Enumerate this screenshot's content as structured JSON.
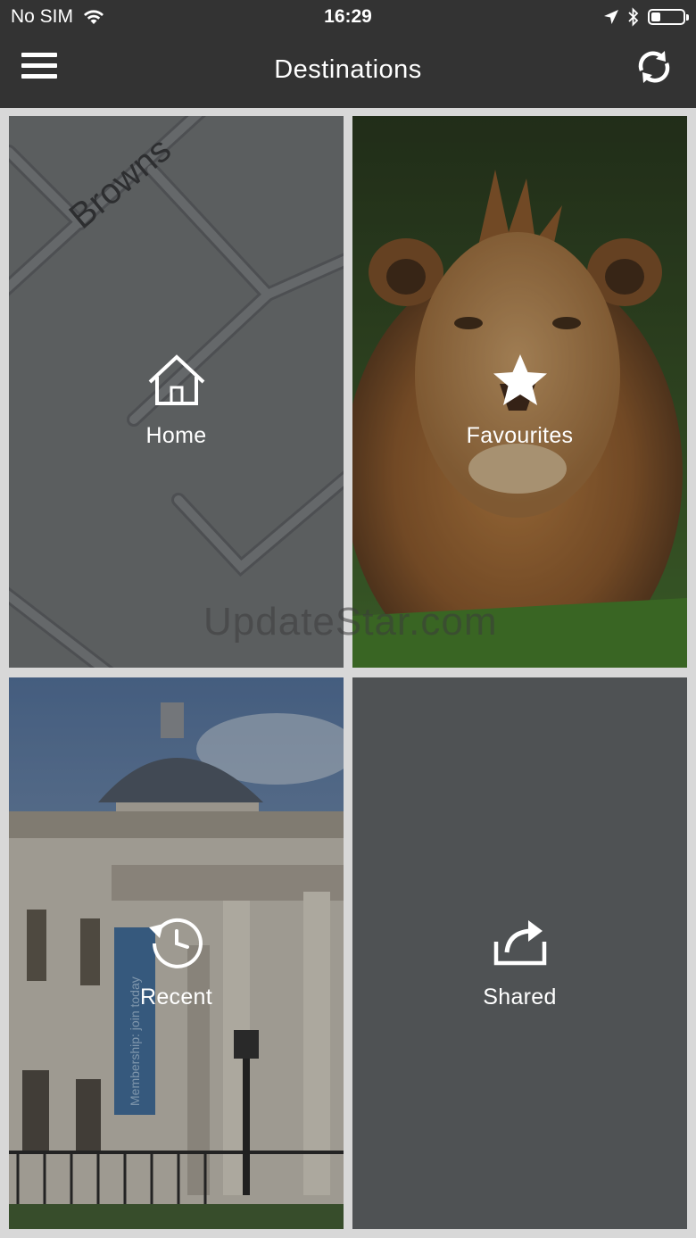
{
  "status_bar": {
    "carrier": "No SIM",
    "time": "16:29",
    "battery_level": 0.3
  },
  "nav": {
    "title": "Destinations",
    "menu_icon": "hamburger-menu-icon",
    "refresh_icon": "refresh-icon"
  },
  "tiles": [
    {
      "label": "Home",
      "icon": "home-icon",
      "background": "map"
    },
    {
      "label": "Favourites",
      "icon": "star-icon",
      "background": "lion-photo"
    },
    {
      "label": "Recent",
      "icon": "clock-history-icon",
      "background": "museum-photo"
    },
    {
      "label": "Shared",
      "icon": "share-icon",
      "background": "#4f5254"
    }
  ],
  "map_street_label": "Browns",
  "museum_banner_text": "Membership: join today",
  "watermark": "UpdateStar.com",
  "colors": {
    "bar_background": "#333333",
    "tile_gap_background": "#d8d8d8",
    "shared_tile_background": "#4f5254"
  }
}
